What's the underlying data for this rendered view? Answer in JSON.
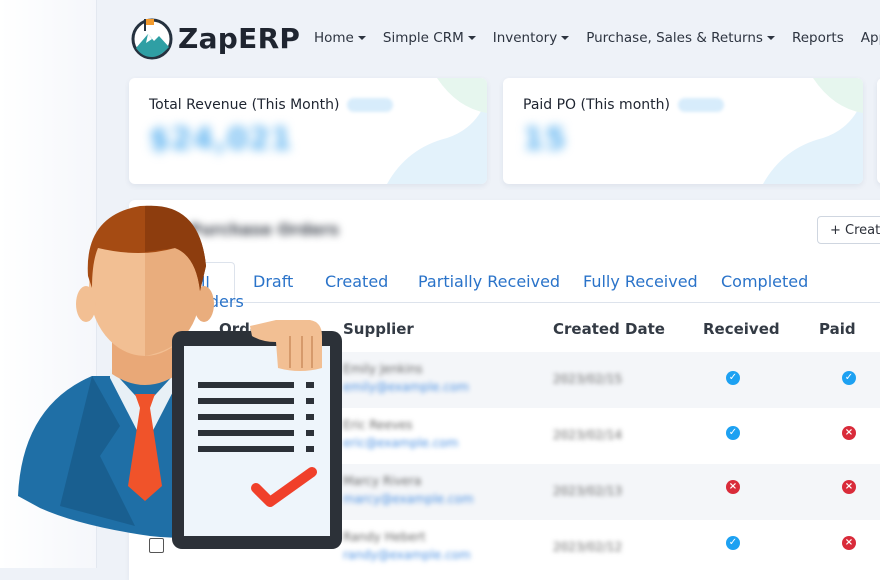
{
  "app": {
    "name": "ZapERP"
  },
  "nav": [
    {
      "label": "Home",
      "has_menu": true
    },
    {
      "label": "Simple CRM",
      "has_menu": true
    },
    {
      "label": "Inventory",
      "has_menu": true
    },
    {
      "label": "Purchase, Sales & Returns",
      "has_menu": true
    },
    {
      "label": "Reports",
      "has_menu": false
    },
    {
      "label": "Apps",
      "has_menu": false
    }
  ],
  "stats": [
    {
      "title": "Total Revenue (This Month)",
      "value": "$24,021"
    },
    {
      "title": "Paid PO (This month)",
      "value": "15"
    }
  ],
  "panel": {
    "title": "Purchase Orders",
    "create_label": "+ Create"
  },
  "tabs": [
    {
      "label": "All Orders",
      "active": true
    },
    {
      "label": "Draft"
    },
    {
      "label": "Created"
    },
    {
      "label": "Partially Received"
    },
    {
      "label": "Fully Received"
    },
    {
      "label": "Completed"
    }
  ],
  "table": {
    "columns": [
      "Order No",
      "Supplier",
      "Created Date",
      "Received",
      "Paid"
    ],
    "rows": [
      {
        "supplier": "Emily Jenkins",
        "email": "emily@example.com",
        "date": "2023/02/15",
        "received": true,
        "paid": true
      },
      {
        "supplier": "Eric Reeves",
        "email": "eric@example.com",
        "date": "2023/02/14",
        "received": true,
        "paid": false
      },
      {
        "supplier": "Marcy Rivera",
        "email": "marcy@example.com",
        "date": "2023/02/13",
        "received": false,
        "paid": false
      },
      {
        "supplier": "Randy Hebert",
        "email": "randy@example.com",
        "date": "2023/02/12",
        "received": true,
        "paid": false
      }
    ]
  },
  "colors": {
    "accent": "#2a73c9",
    "ok": "#1da1f2",
    "no": "#d92b3a",
    "suit": "#1f6fa6",
    "tie": "#f0532a"
  },
  "icons": [
    "check-circle-icon",
    "x-circle-icon",
    "plus-icon",
    "caret-down-icon"
  ]
}
